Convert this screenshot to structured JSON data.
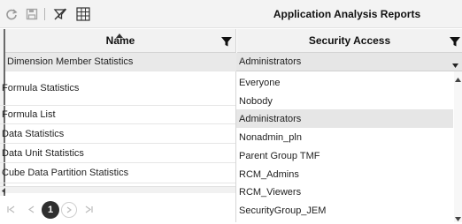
{
  "toolbar": {
    "title": "Application Analysis Reports",
    "icons": [
      "refresh-icon",
      "save-icon",
      "clear-filter-icon",
      "grid-settings-icon"
    ]
  },
  "grid": {
    "columns": [
      {
        "label": "Name",
        "sort": "ascending",
        "filter_icon": "filter-icon"
      },
      {
        "label": "Security Access",
        "filter_icon": "filter-icon"
      }
    ],
    "rows": [
      {
        "name": "Dimension Member Statistics",
        "security": "Administrators"
      },
      {
        "name": "Formula Statistics"
      },
      {
        "name": "Formula List"
      },
      {
        "name": "Data Statistics"
      },
      {
        "name": "Data Unit Statistics"
      },
      {
        "name": "Cube Data Partition Statistics"
      }
    ]
  },
  "security_dropdown": {
    "selected": "Administrators",
    "options": [
      "Everyone",
      "Nobody",
      "Administrators",
      "Nonadmin_pln",
      "Parent Group TMF",
      "RCM_Admins",
      "RCM_Viewers",
      "SecurityGroup_JEM"
    ],
    "highlighted": "Administrators"
  },
  "pager": {
    "current_page": "1"
  },
  "colors": {
    "toolbar_bg": "#f3f3f3",
    "header_bg": "#f2f2f2",
    "selected_row_bg": "#e9e9e9",
    "highlight_bg": "#e6e6e6",
    "pager_active": "#2f2f2f"
  }
}
